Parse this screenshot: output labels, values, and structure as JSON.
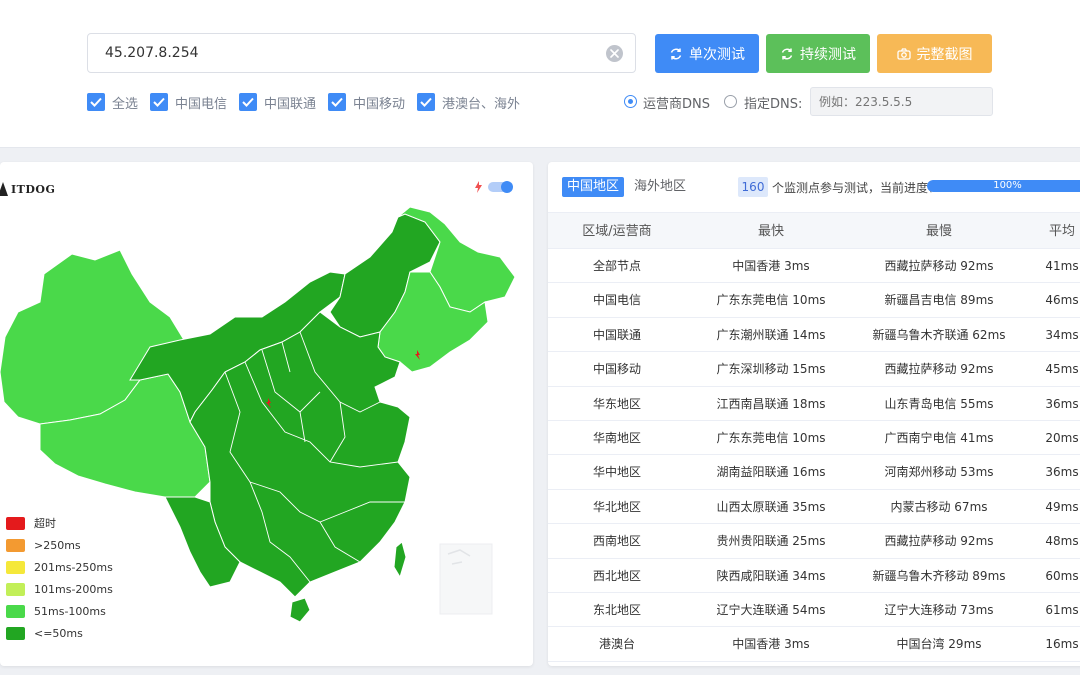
{
  "search": {
    "value": "45.207.8.254"
  },
  "buttons": {
    "single": "单次测试",
    "continuous": "持续测试",
    "screenshot": "完整截图"
  },
  "filters": [
    {
      "label": "全选"
    },
    {
      "label": "中国电信"
    },
    {
      "label": "中国联通"
    },
    {
      "label": "中国移动"
    },
    {
      "label": "港澳台、海外"
    }
  ],
  "dns": {
    "option_carrier": "运营商DNS",
    "option_custom": "指定DNS:",
    "placeholder": "例如：223.5.5.5"
  },
  "map": {
    "logo": "ITDOG",
    "legend": [
      {
        "label": "超时",
        "color": "#e41a1c"
      },
      {
        "label": ">250ms",
        "color": "#f39a31"
      },
      {
        "label": "201ms-250ms",
        "color": "#f5e83a"
      },
      {
        "label": "101ms-200ms",
        "color": "#c2ef58"
      },
      {
        "label": "51ms-100ms",
        "color": "#4ad94a"
      },
      {
        "label": "<=50ms",
        "color": "#22a622"
      }
    ]
  },
  "results": {
    "tabs": {
      "china": "中国地区",
      "overseas": "海外地区"
    },
    "node_count": "160",
    "progress_text": "个监测点参与测试，当前进度：",
    "progress_label": "100%",
    "progress_fraction": 1.0,
    "headers": {
      "region": "区域/运营商",
      "fastest": "最快",
      "slowest": "最慢",
      "average": "平均"
    },
    "rows": [
      {
        "region": "全部节点",
        "fastest": "中国香港 3ms",
        "slowest": "西藏拉萨移动 92ms",
        "average": "41ms"
      },
      {
        "region": "中国电信",
        "fastest": "广东东莞电信 10ms",
        "slowest": "新疆昌吉电信 89ms",
        "average": "46ms"
      },
      {
        "region": "中国联通",
        "fastest": "广东潮州联通 14ms",
        "slowest": "新疆乌鲁木齐联通 62ms",
        "average": "34ms"
      },
      {
        "region": "中国移动",
        "fastest": "广东深圳移动 15ms",
        "slowest": "西藏拉萨移动 92ms",
        "average": "45ms"
      },
      {
        "region": "华东地区",
        "fastest": "江西南昌联通 18ms",
        "slowest": "山东青岛电信 55ms",
        "average": "36ms"
      },
      {
        "region": "华南地区",
        "fastest": "广东东莞电信 10ms",
        "slowest": "广西南宁电信 41ms",
        "average": "20ms"
      },
      {
        "region": "华中地区",
        "fastest": "湖南益阳联通 16ms",
        "slowest": "河南郑州移动 53ms",
        "average": "36ms"
      },
      {
        "region": "华北地区",
        "fastest": "山西太原联通 35ms",
        "slowest": "内蒙古移动 67ms",
        "average": "49ms"
      },
      {
        "region": "西南地区",
        "fastest": "贵州贵阳联通 25ms",
        "slowest": "西藏拉萨移动 92ms",
        "average": "48ms"
      },
      {
        "region": "西北地区",
        "fastest": "陕西咸阳联通 34ms",
        "slowest": "新疆乌鲁木齐移动 89ms",
        "average": "60ms"
      },
      {
        "region": "东北地区",
        "fastest": "辽宁大连联通 54ms",
        "slowest": "辽宁大连移动 73ms",
        "average": "61ms"
      },
      {
        "region": "港澳台",
        "fastest": "中国香港 3ms",
        "slowest": "中国台湾 29ms",
        "average": "16ms"
      }
    ]
  }
}
